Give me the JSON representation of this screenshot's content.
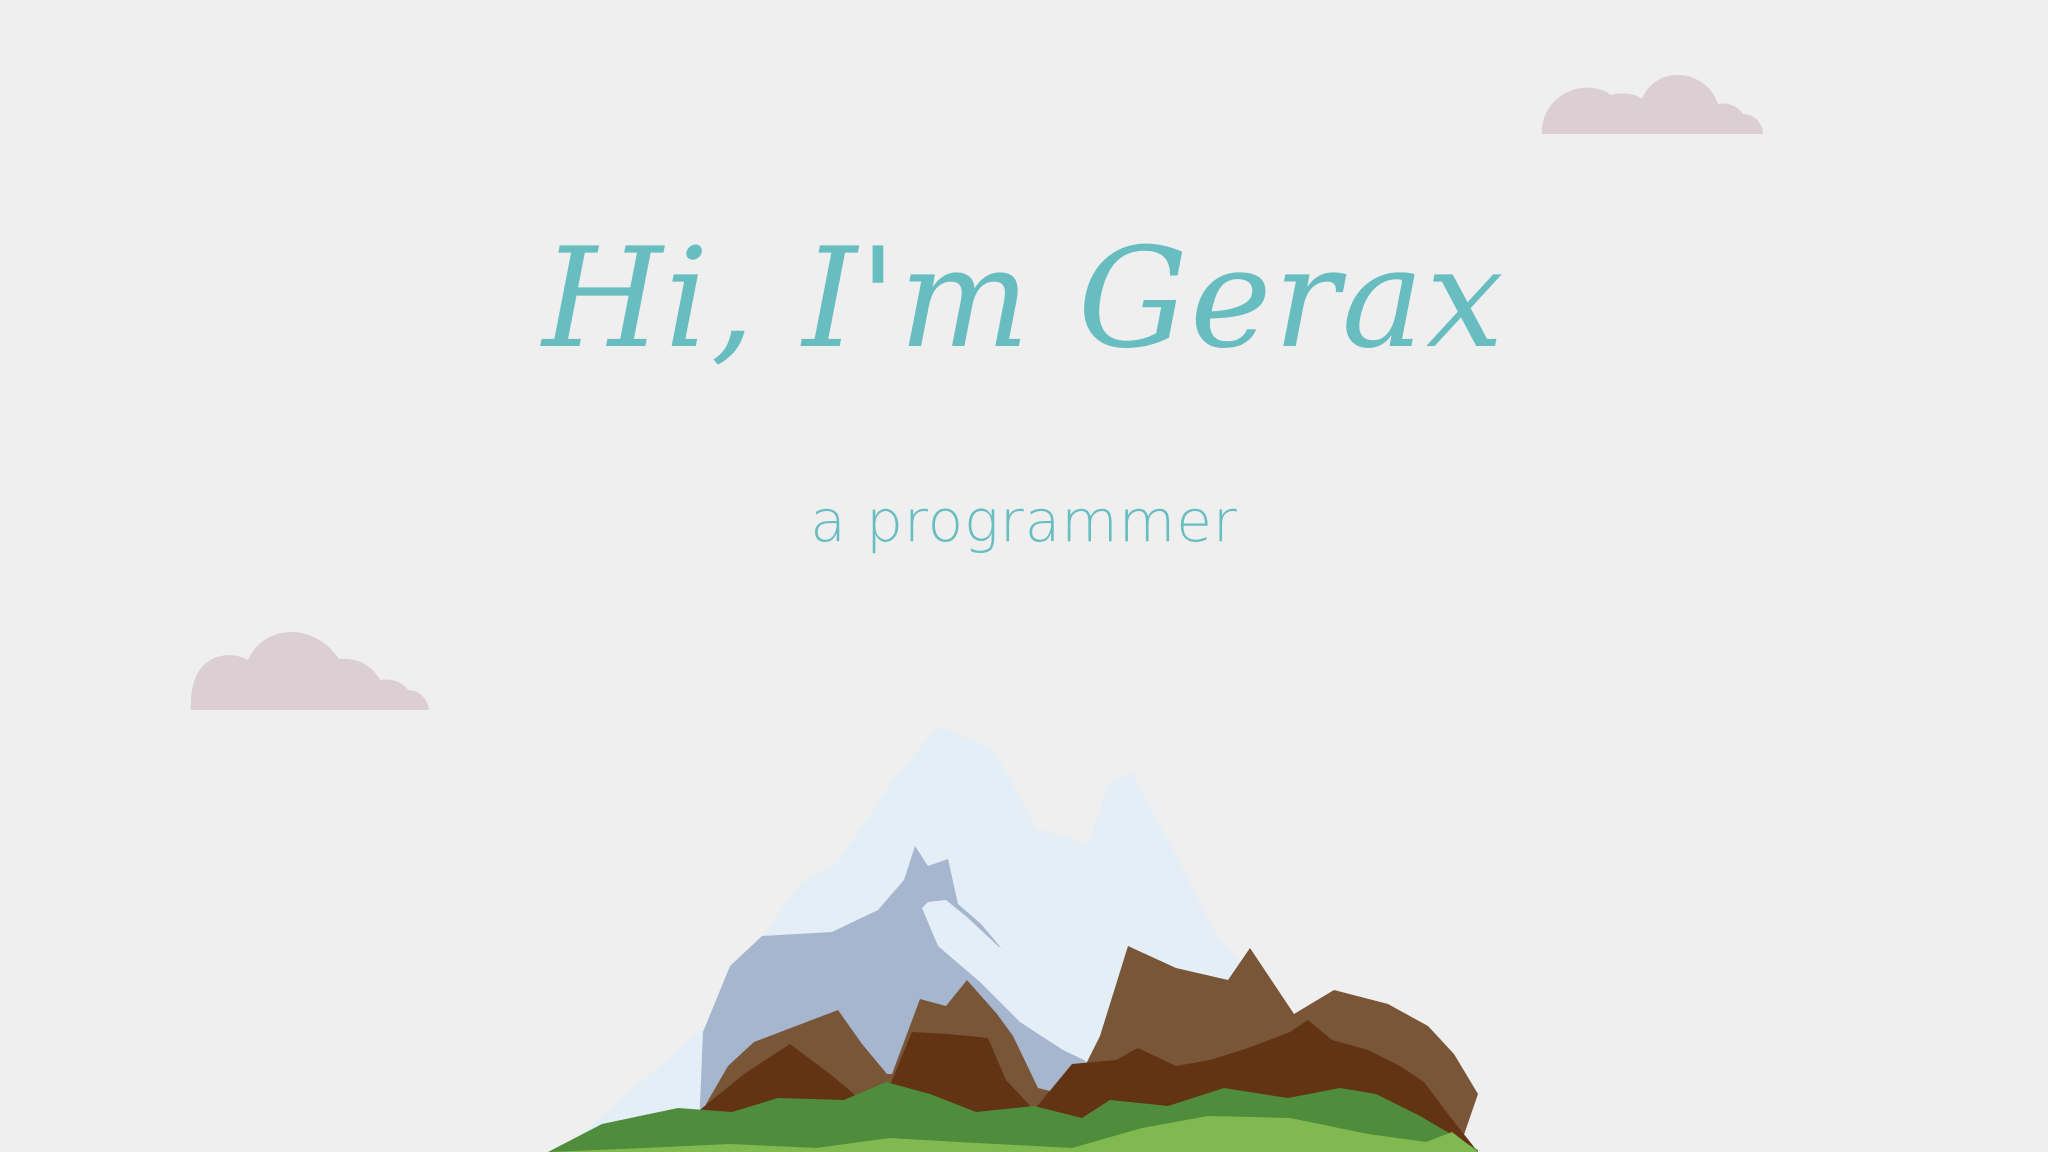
{
  "hero": {
    "title": "Hi, I'm Gerax",
    "subtitle": "a programmer"
  },
  "colors": {
    "background": "#efefef",
    "accent": "#67bdc0",
    "cloud": "#dccfd3",
    "snow": "#e4eef7",
    "shadow": "#a5b6ce",
    "rock_light": "#795637",
    "rock_dark": "#623413",
    "grass_dark": "#4f8c3c",
    "grass_light": "#80b94f"
  },
  "decorations": {
    "clouds": [
      "cloud",
      "cloud"
    ],
    "landscape": "mountain"
  }
}
